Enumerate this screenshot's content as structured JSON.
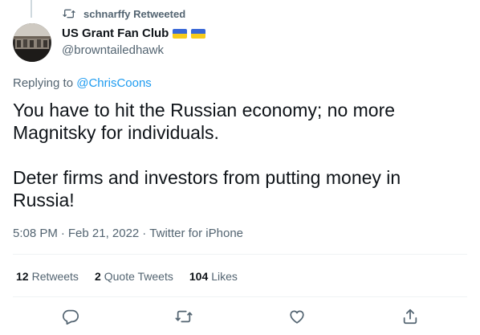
{
  "social_context": {
    "icon": "retweet-icon",
    "text": "schnarffy Retweeted"
  },
  "author": {
    "display_name": "US Grant Fan Club",
    "badges": [
      "ukraine-flag-icon",
      "ukraine-flag-icon"
    ],
    "handle": "@browntailedhawk"
  },
  "reply": {
    "prefix": "Replying to",
    "mention": "@ChrisCoons"
  },
  "tweet": {
    "paragraphs": [
      "You have to hit the Russian economy; no more Magnitsky for individuals.",
      "Deter firms and investors from putting money in Russia!"
    ]
  },
  "meta": {
    "time": "5:08 PM",
    "separator": "·",
    "date": "Feb 21, 2022",
    "source": "Twitter for iPhone"
  },
  "stats": [
    {
      "count": "12",
      "label": "Retweets"
    },
    {
      "count": "2",
      "label": "Quote Tweets"
    },
    {
      "count": "104",
      "label": "Likes"
    }
  ],
  "actions": [
    {
      "icon": "reply-icon"
    },
    {
      "icon": "retweet-icon"
    },
    {
      "icon": "like-icon"
    },
    {
      "icon": "share-icon"
    }
  ],
  "colors": {
    "accent": "#1d9bf0",
    "text_primary": "#0f1419",
    "text_secondary": "#536471",
    "divider": "#eff3f4",
    "flag_blue": "#3867d6",
    "flag_yellow": "#f7cb1a"
  }
}
